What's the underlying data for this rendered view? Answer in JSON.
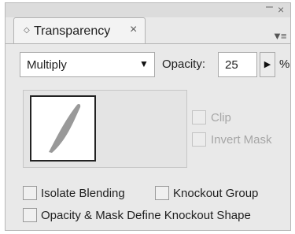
{
  "panel": {
    "tab": {
      "title": "Transparency",
      "icon": "diamond-icon",
      "close_icon": "close-icon"
    },
    "window_controls": {
      "minimize": "–",
      "close": "×"
    },
    "menu_icon": "panel-menu-icon"
  },
  "blending": {
    "mode": "Multiply",
    "dropdown_icon": "chevron-down-icon"
  },
  "opacity": {
    "label": "Opacity:",
    "value": "25",
    "unit": "%",
    "arrow_icon": "arrow-right-icon"
  },
  "mask_options": {
    "clip": "Clip",
    "invert_mask": "Invert Mask"
  },
  "group_options": {
    "isolate_blending": "Isolate Blending",
    "knockout_group": "Knockout Group",
    "define_knockout_shape": "Opacity & Mask Define Knockout Shape"
  },
  "colors": {
    "panel_bg": "#e9e9e9",
    "shape_fill": "#999999"
  }
}
